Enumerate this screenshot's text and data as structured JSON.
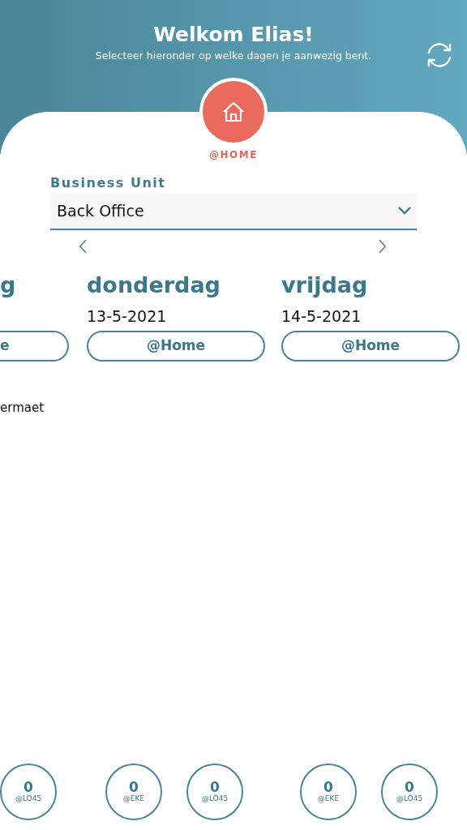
{
  "header": {
    "title": "Welkom Elias!",
    "subtitle": "Selecteer hieronder op welke dagen je aanwezig bent."
  },
  "location": {
    "label": "@HOME"
  },
  "business_unit": {
    "label": "Business Unit",
    "value": "Back Office"
  },
  "days": [
    {
      "name": "g",
      "button": "e",
      "note": "ermaet",
      "counters": [
        {
          "count": "0",
          "label": "@LO45"
        }
      ]
    },
    {
      "name": "donderdag",
      "date": "13-5-2021",
      "button": "@Home",
      "counters": [
        {
          "count": "0",
          "label": "@EKE"
        },
        {
          "count": "0",
          "label": "@LO45"
        }
      ]
    },
    {
      "name": "vrijdag",
      "date": "14-5-2021",
      "button": "@Home",
      "counters": [
        {
          "count": "0",
          "label": "@EKE"
        },
        {
          "count": "0",
          "label": "@LO45"
        }
      ]
    }
  ]
}
